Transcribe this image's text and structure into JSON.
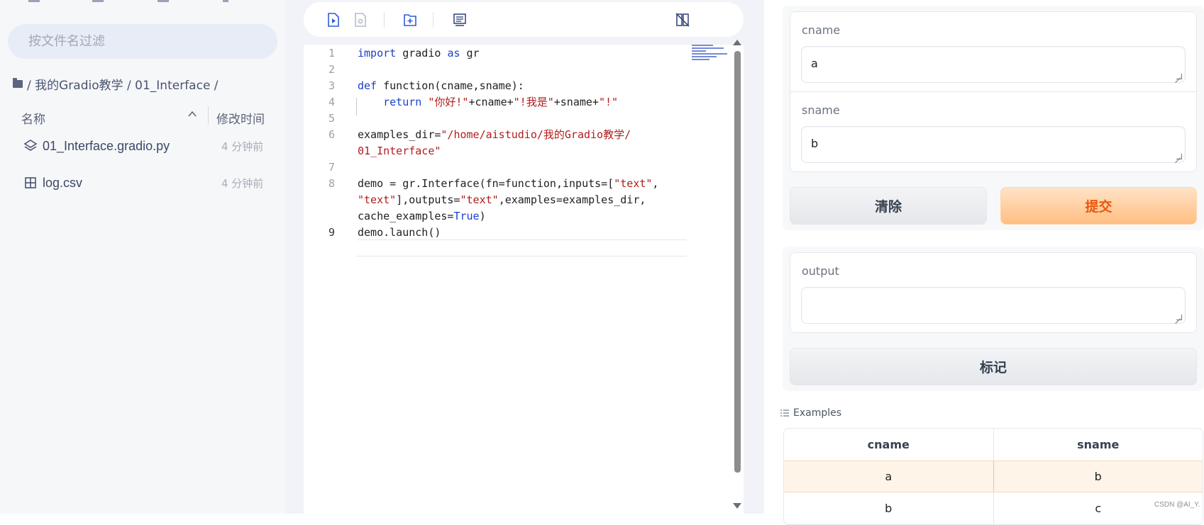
{
  "file_panel": {
    "search_placeholder": "按文件名过滤",
    "breadcrumb": "/ 我的Gradio教学 / 01_Interface /",
    "column_name": "名称",
    "column_time": "修改时间",
    "files": [
      {
        "name": "01_Interface.gradio.py",
        "time": "4 分钟前",
        "icon": "gradio-file-icon"
      },
      {
        "name": "log.csv",
        "time": "4 分钟前",
        "icon": "table-file-icon"
      }
    ]
  },
  "editor": {
    "toolbar_icons": [
      "run-file-icon",
      "save-icon",
      "new-file-icon",
      "terminal-icon",
      "disable-minimap-icon"
    ],
    "line_numbers": [
      "1",
      "2",
      "3",
      "4",
      "5",
      "6",
      "",
      "7",
      "8",
      "",
      "",
      "9"
    ],
    "active_line": "9"
  },
  "gradio": {
    "input1_label": "cname",
    "input1_value": "a",
    "input2_label": "sname",
    "input2_value": "b",
    "clear_label": "清除",
    "submit_label": "提交",
    "output_label": "output",
    "output_value": "",
    "flag_label": "标记",
    "examples_title": "Examples",
    "examples_headers": [
      "cname",
      "sname"
    ],
    "examples_rows": [
      [
        "a",
        "b"
      ],
      [
        "b",
        "c"
      ]
    ]
  },
  "watermark": "CSDN @AI_Y.",
  "colors": {
    "accent_orange": "#ea580c",
    "keyword_blue": "#1b3ecc",
    "string_red": "#b01d1d"
  }
}
